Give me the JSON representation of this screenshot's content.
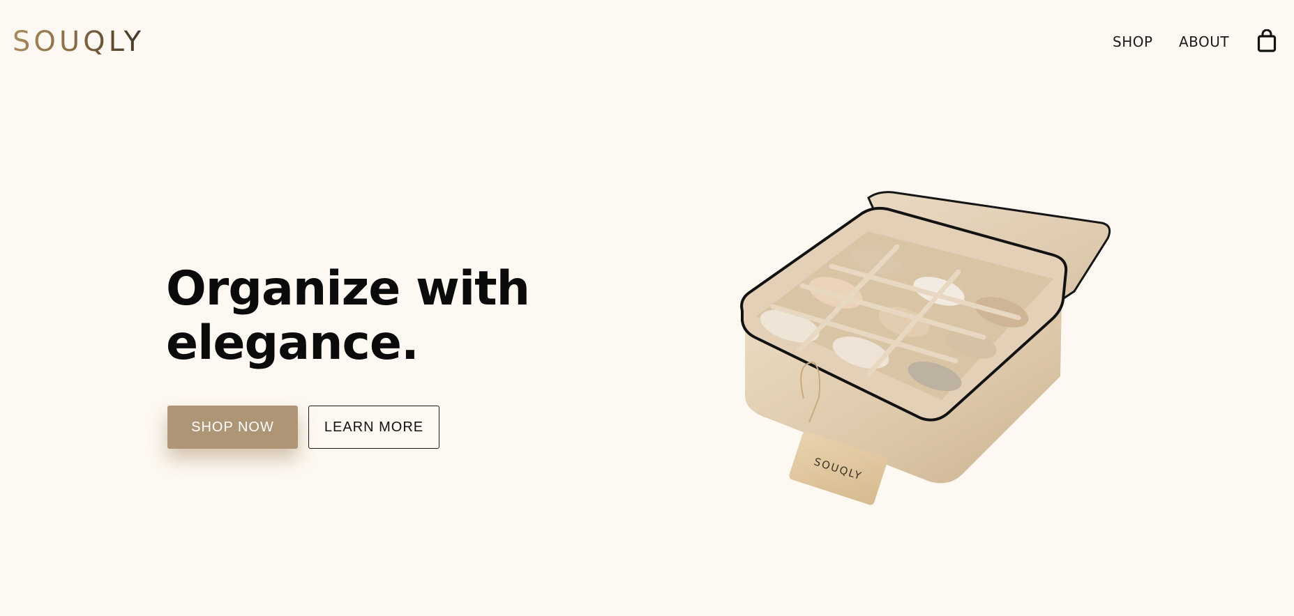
{
  "header": {
    "logo": "SOUQLY",
    "nav": [
      {
        "label": "SHOP"
      },
      {
        "label": "ABOUT"
      }
    ],
    "cart_icon": "shopping-bag-icon"
  },
  "hero": {
    "headline_line1": "Organize with",
    "headline_line2": "elegance.",
    "primary_button": "SHOP NOW",
    "secondary_button": "LEARN MORE",
    "product_tag_text": "SOUQLY"
  },
  "colors": {
    "background": "#fdf8f1",
    "accent": "#ae9576",
    "text": "#0b0b0b"
  }
}
